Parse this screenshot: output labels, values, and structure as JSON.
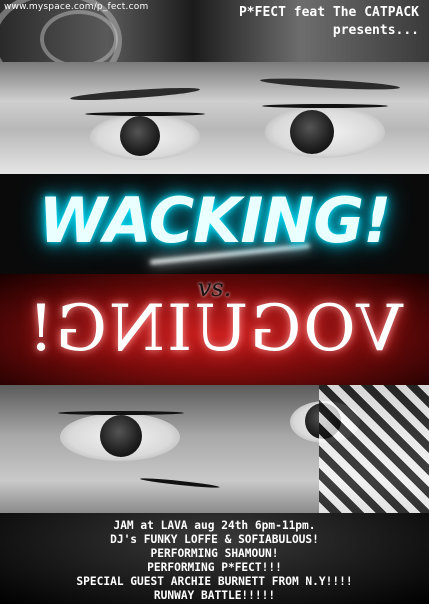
{
  "header": {
    "url": "www.myspace.com/p_fect.com",
    "presenter_line1": "P*FECT feat The CATPACK",
    "presenter_line2": "presents..."
  },
  "title": {
    "main": "WACKING!",
    "versus": "vs.",
    "secondary": "VOGUING!"
  },
  "details": {
    "lines": [
      "JAM at LAVA aug 24th 6pm-11pm.",
      "DJ's FUNKY LOFFE & SOFIABULOUS!",
      "PERFORMING SHAMOUN!",
      "PERFORMING P*FECT!!!",
      "SPECIAL GUEST ARCHIE BURNETT FROM N.Y!!!!",
      "RUNWAY BATTLE!!!!!"
    ]
  },
  "colors": {
    "neon_cyan": "#00e5ff",
    "neon_red": "#c21a1a"
  }
}
